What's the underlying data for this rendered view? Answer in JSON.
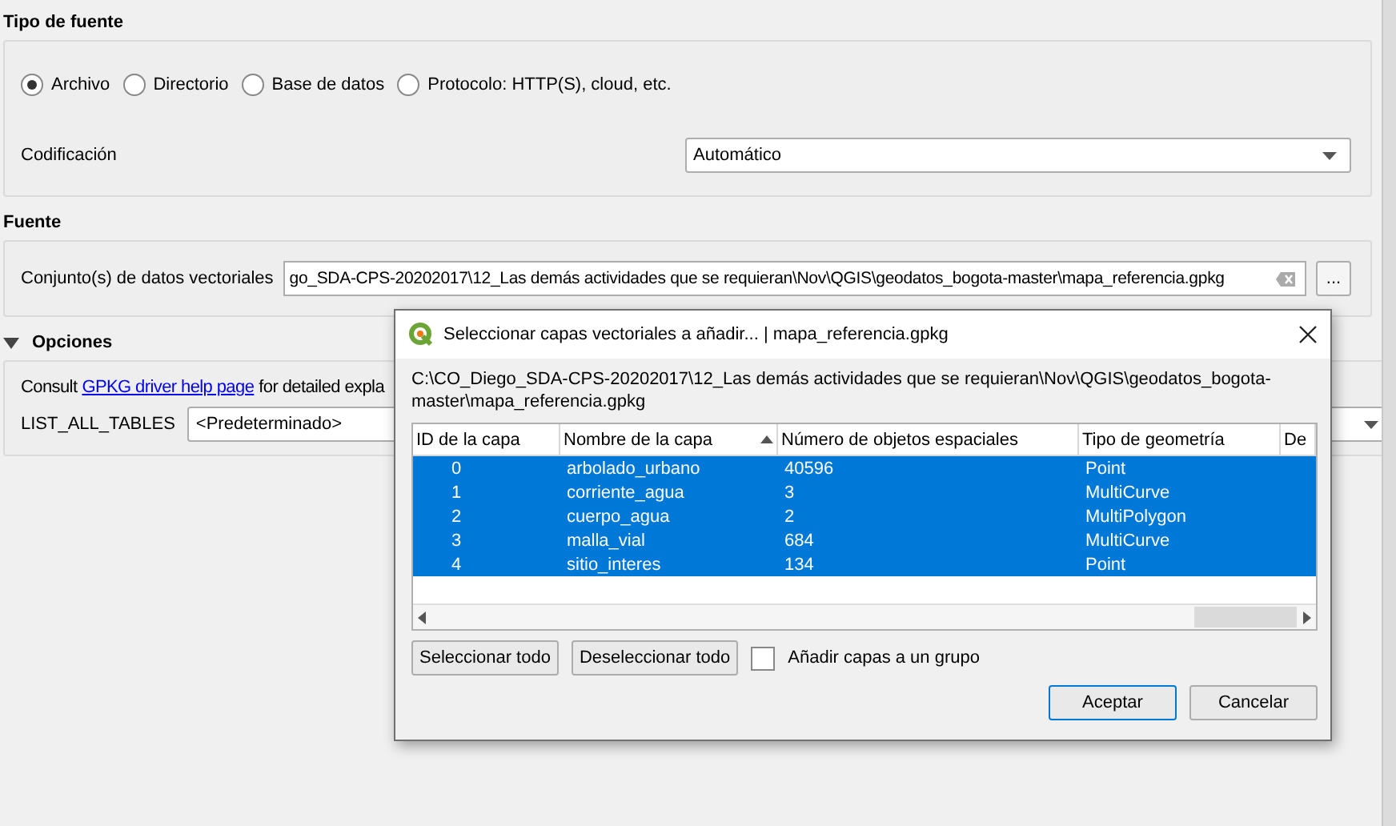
{
  "source_type": {
    "title": "Tipo de fuente",
    "options": [
      {
        "label": "Archivo",
        "selected": true
      },
      {
        "label": "Directorio",
        "selected": false
      },
      {
        "label": "Base de datos",
        "selected": false
      },
      {
        "label": "Protocolo: HTTP(S), cloud, etc.",
        "selected": false
      }
    ],
    "encoding_label": "Codificación",
    "encoding_value": "Automático"
  },
  "source": {
    "title": "Fuente",
    "label": "Conjunto(s) de datos vectoriales",
    "value": "go_SDA-CPS-20202017\\12_Las demás actividades que se requieran\\Nov\\QGIS\\geodatos_bogota-master\\mapa_referencia.gpkg",
    "browse": "..."
  },
  "options": {
    "title": "Opciones",
    "expanded": true,
    "consult_prefix": "Consult",
    "link": "GPKG driver help page",
    "consult_suffix": "for detailed expla",
    "option_label": "LIST_ALL_TABLES",
    "option_value": "<Predeterminado>"
  },
  "dialog": {
    "title": "Seleccionar capas vectoriales a añadir... | mapa_referencia.gpkg",
    "path": "C:\\CO_Diego_SDA-CPS-20202017\\12_Las demás actividades que se requieran\\Nov\\QGIS\\geodatos_bogota-master\\mapa_referencia.gpkg",
    "columns": [
      "ID de la capa",
      "Nombre de la capa",
      "Número de objetos espaciales",
      "Tipo de geometría",
      "De"
    ],
    "rows": [
      {
        "cells": [
          "0",
          "arbolado_urbano",
          "40596",
          "Point"
        ],
        "selected": true
      },
      {
        "cells": [
          "1",
          "corriente_agua",
          "3",
          "MultiCurve"
        ],
        "selected": true
      },
      {
        "cells": [
          "2",
          "cuerpo_agua",
          "2",
          "MultiPolygon"
        ],
        "selected": true
      },
      {
        "cells": [
          "3",
          "malla_vial",
          "684",
          "MultiCurve"
        ],
        "selected": true
      },
      {
        "cells": [
          "4",
          "sitio_interes",
          "134",
          "Point"
        ],
        "selected": true
      }
    ],
    "select_all": "Seleccionar todo",
    "deselect_all": "Deseleccionar todo",
    "group_checkbox": {
      "label": "Añadir capas a un grupo",
      "checked": false
    },
    "ok": "Aceptar",
    "cancel": "Cancelar"
  }
}
